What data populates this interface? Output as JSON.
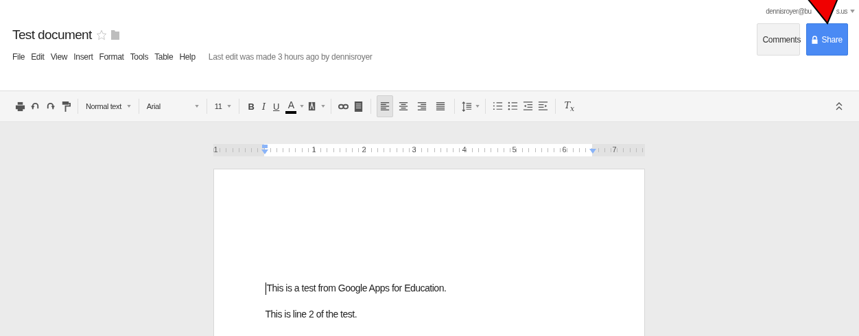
{
  "account": {
    "text_before_arrow": "dennisroyer@bu",
    "text_after_arrow": "s.us"
  },
  "document": {
    "title": "Test document"
  },
  "buttons": [
    {
      "kind": "comments",
      "label": "Comments"
    },
    {
      "kind": "share",
      "label": "Share"
    }
  ],
  "menu": [
    "File",
    "Edit",
    "View",
    "Insert",
    "Format",
    "Tools",
    "Table",
    "Help"
  ],
  "last_edit": "Last edit was made 3 hours ago by dennisroyer",
  "toolbar": [
    {
      "kind": "print"
    },
    {
      "kind": "undo"
    },
    {
      "kind": "redo"
    },
    {
      "kind": "paint"
    },
    {
      "kind": "sep"
    },
    {
      "kind": "style_select",
      "label": "Normal text"
    },
    {
      "kind": "sep"
    },
    {
      "kind": "font_select",
      "label": "Arial"
    },
    {
      "kind": "sep"
    },
    {
      "kind": "size_select",
      "label": "11"
    },
    {
      "kind": "sep"
    },
    {
      "kind": "bold",
      "label": "B"
    },
    {
      "kind": "italic",
      "label": "I"
    },
    {
      "kind": "underline",
      "label": "U"
    },
    {
      "kind": "textcolor",
      "label": "A",
      "color": "#000000"
    },
    {
      "kind": "highlight"
    },
    {
      "kind": "sep"
    },
    {
      "kind": "link"
    },
    {
      "kind": "comment"
    },
    {
      "kind": "sep"
    },
    {
      "kind": "align_left",
      "selected": true
    },
    {
      "kind": "align_center",
      "selected": false
    },
    {
      "kind": "align_right",
      "selected": false
    },
    {
      "kind": "align_justify",
      "selected": false
    },
    {
      "kind": "sep"
    },
    {
      "kind": "linespacing"
    },
    {
      "kind": "sep"
    },
    {
      "kind": "numbered"
    },
    {
      "kind": "bulleted"
    },
    {
      "kind": "outdent"
    },
    {
      "kind": "indent"
    },
    {
      "kind": "sep"
    },
    {
      "kind": "clear_format",
      "label": "T$_{x}$"
    }
  ],
  "ruler": {
    "labels": [
      "1",
      "1",
      "2",
      "3",
      "4",
      "5",
      "6",
      "7"
    ]
  },
  "body": [
    "This is a test from Google Apps for Education.",
    "This is line 2 of the test."
  ]
}
